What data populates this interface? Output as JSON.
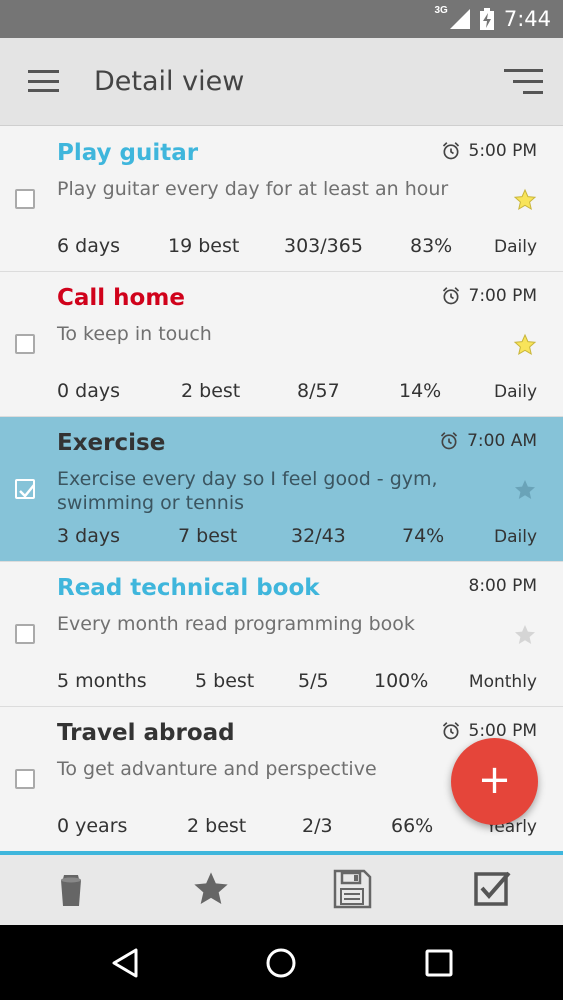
{
  "status_bar": {
    "network": "3G",
    "time": "7:44"
  },
  "app_bar": {
    "title": "Detail view",
    "menu_icon": "hamburger-menu-icon",
    "sort_icon": "sort-icon"
  },
  "colors": {
    "accent": "#3fb6dc",
    "title_blue": "#3fb6dc",
    "title_red": "#d0021b",
    "selected_row": "#86c3d8",
    "fab": "#e5453a",
    "star_yellow": "#f8e45a"
  },
  "tasks": [
    {
      "title": "Play guitar",
      "description": "Play guitar every day for at least an hour",
      "time": "5:00 PM",
      "alarm": true,
      "starred": true,
      "checked": false,
      "streak": "6 days",
      "best": "19 best",
      "ratio": "303/365",
      "percent": "83%",
      "frequency": "Daily"
    },
    {
      "title": "Call home",
      "description": "To keep in touch",
      "time": "7:00 PM",
      "alarm": true,
      "starred": true,
      "checked": false,
      "streak": "0 days",
      "best": "2 best",
      "ratio": "8/57",
      "percent": "14%",
      "frequency": "Daily"
    },
    {
      "title": "Exercise",
      "description": "Exercise every day so I feel good - gym, swimming or tennis",
      "time": "7:00 AM",
      "alarm": true,
      "starred": false,
      "checked": true,
      "streak": "3 days",
      "best": "7 best",
      "ratio": "32/43",
      "percent": "74%",
      "frequency": "Daily"
    },
    {
      "title": "Read technical book",
      "description": "Every month read programming book",
      "time": "8:00 PM",
      "alarm": false,
      "starred": false,
      "checked": false,
      "streak": "5 months",
      "best": "5 best",
      "ratio": "5/5",
      "percent": "100%",
      "frequency": "Monthly"
    },
    {
      "title": "Travel abroad",
      "description": "To get advanture and perspective",
      "time": "5:00 PM",
      "alarm": true,
      "starred": false,
      "checked": false,
      "streak": "0 years",
      "best": "2 best",
      "ratio": "2/3",
      "percent": "66%",
      "frequency": "Yearly"
    }
  ],
  "fab": {
    "label": "+"
  },
  "toolbar": {
    "buttons": [
      "trash-icon",
      "star-icon",
      "save-icon",
      "checkbox-icon"
    ]
  },
  "nav_bar": {
    "buttons": [
      "back-icon",
      "home-icon",
      "recents-icon"
    ]
  }
}
